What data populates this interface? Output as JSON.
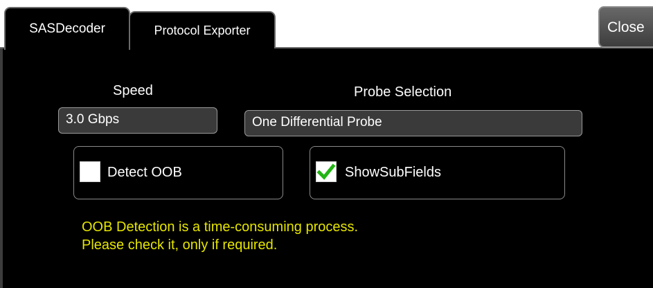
{
  "tabs": [
    {
      "label": "SASDecoder",
      "active": true
    },
    {
      "label": "Protocol Exporter",
      "active": false
    }
  ],
  "close_label": "Close",
  "speed": {
    "label": "Speed",
    "value": "3.0 Gbps"
  },
  "probe": {
    "label": "Probe Selection",
    "value": "One Differential Probe"
  },
  "detect_oob": {
    "label": "Detect OOB",
    "checked": false
  },
  "show_subfields": {
    "label": "ShowSubFields",
    "checked": true
  },
  "warning": {
    "line1": "OOB Detection is a time-consuming process.",
    "line2": "Please check it, only if required."
  },
  "colors": {
    "warning_text": "#e6e600",
    "check_mark": "#22b414"
  }
}
